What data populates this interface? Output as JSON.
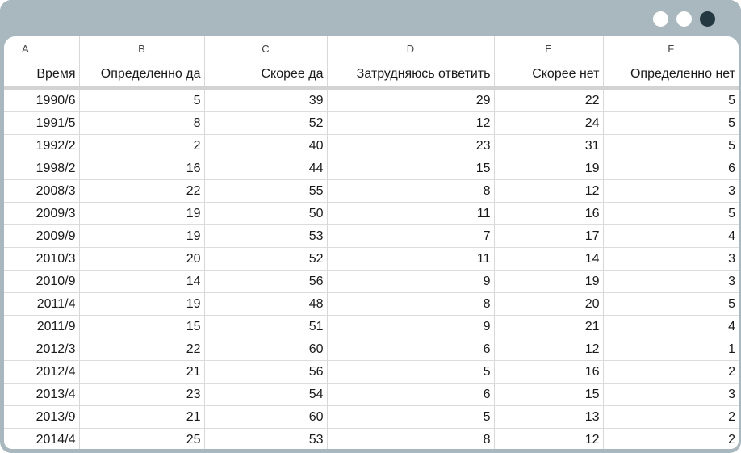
{
  "columns": [
    "A",
    "B",
    "C",
    "D",
    "E",
    "F"
  ],
  "headers": [
    "Время",
    "Определенно да",
    "Скорее да",
    "Затрудняюсь ответить",
    "Скорее нет",
    "Определенно нет"
  ],
  "rows": [
    [
      "1990/6",
      "5",
      "39",
      "29",
      "22",
      "5"
    ],
    [
      "1991/5",
      "8",
      "52",
      "12",
      "24",
      "5"
    ],
    [
      "1992/2",
      "2",
      "40",
      "23",
      "31",
      "5"
    ],
    [
      "1998/2",
      "16",
      "44",
      "15",
      "19",
      "6"
    ],
    [
      "2008/3",
      "22",
      "55",
      "8",
      "12",
      "3"
    ],
    [
      "2009/3",
      "19",
      "50",
      "11",
      "16",
      "5"
    ],
    [
      "2009/9",
      "19",
      "53",
      "7",
      "17",
      "4"
    ],
    [
      "2010/3",
      "20",
      "52",
      "11",
      "14",
      "3"
    ],
    [
      "2010/9",
      "14",
      "56",
      "9",
      "19",
      "3"
    ],
    [
      "2011/4",
      "19",
      "48",
      "8",
      "20",
      "5"
    ],
    [
      "2011/9",
      "15",
      "51",
      "9",
      "21",
      "4"
    ],
    [
      "2012/3",
      "22",
      "60",
      "6",
      "12",
      "1"
    ],
    [
      "2012/4",
      "21",
      "56",
      "5",
      "16",
      "2"
    ],
    [
      "2013/4",
      "23",
      "54",
      "6",
      "15",
      "3"
    ],
    [
      "2013/9",
      "21",
      "60",
      "5",
      "13",
      "2"
    ],
    [
      "2014/4",
      "25",
      "53",
      "8",
      "12",
      "2"
    ]
  ]
}
